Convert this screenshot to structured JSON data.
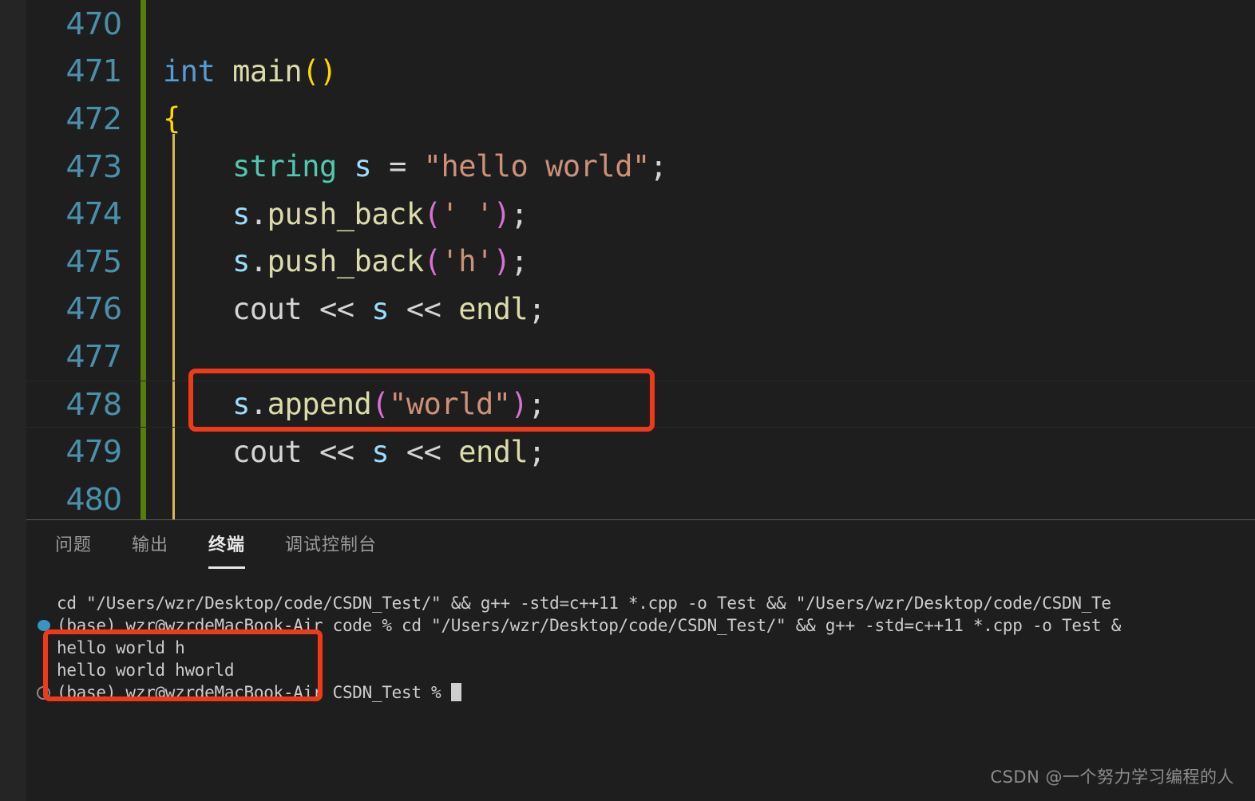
{
  "editor": {
    "lines": [
      {
        "number": "470",
        "tokens": []
      },
      {
        "number": "471",
        "tokens": [
          {
            "text": "int",
            "cls": "t-kw"
          },
          {
            "text": " ",
            "cls": "t-plain"
          },
          {
            "text": "main",
            "cls": "t-fn"
          },
          {
            "text": "()",
            "cls": "t-brace"
          }
        ]
      },
      {
        "number": "472",
        "tokens": [
          {
            "text": "{",
            "cls": "t-brace"
          }
        ]
      },
      {
        "number": "473",
        "tokens": [
          {
            "text": "    ",
            "cls": "t-plain"
          },
          {
            "text": "string",
            "cls": "t-type"
          },
          {
            "text": " ",
            "cls": "t-plain"
          },
          {
            "text": "s",
            "cls": "t-var"
          },
          {
            "text": " ",
            "cls": "t-plain"
          },
          {
            "text": "=",
            "cls": "t-op"
          },
          {
            "text": " ",
            "cls": "t-plain"
          },
          {
            "text": "\"hello world\"",
            "cls": "t-str"
          },
          {
            "text": ";",
            "cls": "t-punc"
          }
        ]
      },
      {
        "number": "474",
        "tokens": [
          {
            "text": "    ",
            "cls": "t-plain"
          },
          {
            "text": "s",
            "cls": "t-var"
          },
          {
            "text": ".",
            "cls": "t-punc"
          },
          {
            "text": "push_back",
            "cls": "t-fn"
          },
          {
            "text": "(",
            "cls": "t-paren-m"
          },
          {
            "text": "' '",
            "cls": "t-str"
          },
          {
            "text": ")",
            "cls": "t-paren-m"
          },
          {
            "text": ";",
            "cls": "t-punc"
          }
        ]
      },
      {
        "number": "475",
        "tokens": [
          {
            "text": "    ",
            "cls": "t-plain"
          },
          {
            "text": "s",
            "cls": "t-var"
          },
          {
            "text": ".",
            "cls": "t-punc"
          },
          {
            "text": "push_back",
            "cls": "t-fn"
          },
          {
            "text": "(",
            "cls": "t-paren-m"
          },
          {
            "text": "'h'",
            "cls": "t-str"
          },
          {
            "text": ")",
            "cls": "t-paren-m"
          },
          {
            "text": ";",
            "cls": "t-punc"
          }
        ]
      },
      {
        "number": "476",
        "tokens": [
          {
            "text": "    ",
            "cls": "t-plain"
          },
          {
            "text": "cout",
            "cls": "t-plain"
          },
          {
            "text": " << ",
            "cls": "t-op"
          },
          {
            "text": "s",
            "cls": "t-var"
          },
          {
            "text": " << ",
            "cls": "t-op"
          },
          {
            "text": "endl",
            "cls": "t-fn"
          },
          {
            "text": ";",
            "cls": "t-punc"
          }
        ]
      },
      {
        "number": "477",
        "tokens": []
      },
      {
        "number": "478",
        "current": true,
        "tokens": [
          {
            "text": "    ",
            "cls": "t-plain"
          },
          {
            "text": "s",
            "cls": "t-var"
          },
          {
            "text": ".",
            "cls": "t-punc"
          },
          {
            "text": "append",
            "cls": "t-fn"
          },
          {
            "text": "(",
            "cls": "t-paren-m"
          },
          {
            "text": "\"world\"",
            "cls": "t-str"
          },
          {
            "text": ")",
            "cls": "t-paren-m"
          },
          {
            "text": ";",
            "cls": "t-punc"
          }
        ]
      },
      {
        "number": "479",
        "tokens": [
          {
            "text": "    ",
            "cls": "t-plain"
          },
          {
            "text": "cout",
            "cls": "t-plain"
          },
          {
            "text": " << ",
            "cls": "t-op"
          },
          {
            "text": "s",
            "cls": "t-var"
          },
          {
            "text": " << ",
            "cls": "t-op"
          },
          {
            "text": "endl",
            "cls": "t-fn"
          },
          {
            "text": ";",
            "cls": "t-punc"
          }
        ]
      },
      {
        "number": "480",
        "tokens": []
      }
    ]
  },
  "panel": {
    "tabs": [
      {
        "label": "问题",
        "active": false
      },
      {
        "label": "输出",
        "active": false
      },
      {
        "label": "终端",
        "active": true
      },
      {
        "label": "调试控制台",
        "active": false
      }
    ]
  },
  "terminal": {
    "lines": [
      {
        "marker": "none",
        "text": "cd \"/Users/wzr/Desktop/code/CSDN_Test/\" && g++ -std=c++11 *.cpp -o Test && \"/Users/wzr/Desktop/code/CSDN_Te"
      },
      {
        "marker": "dot",
        "text": "(base) wzr@wzrdeMacBook-Air code % cd \"/Users/wzr/Desktop/code/CSDN_Test/\" && g++ -std=c++11 *.cpp -o Test &"
      },
      {
        "marker": "none",
        "text": "hello world h"
      },
      {
        "marker": "none",
        "text": "hello world hworld"
      },
      {
        "marker": "circle",
        "text": "(base) wzr@wzrdeMacBook-Air CSDN_Test % ",
        "cursor": true
      }
    ]
  },
  "watermark": {
    "text": "CSDN @一个努力学习编程的人"
  },
  "colors": {
    "editor_background": "#1e1e1e",
    "strip_background": "#252526",
    "line_number": "#4a90ab",
    "git_modified_bar": "#587c0c",
    "indent_guide": "#d7ba4e",
    "annotation_red": "#f03a17",
    "terminal_text": "#cccccc",
    "tab_active": "#e7e7e7",
    "tab_inactive": "#9a9a9a",
    "marker_blue": "#3794c7",
    "marker_gray": "#8a8a8a"
  }
}
